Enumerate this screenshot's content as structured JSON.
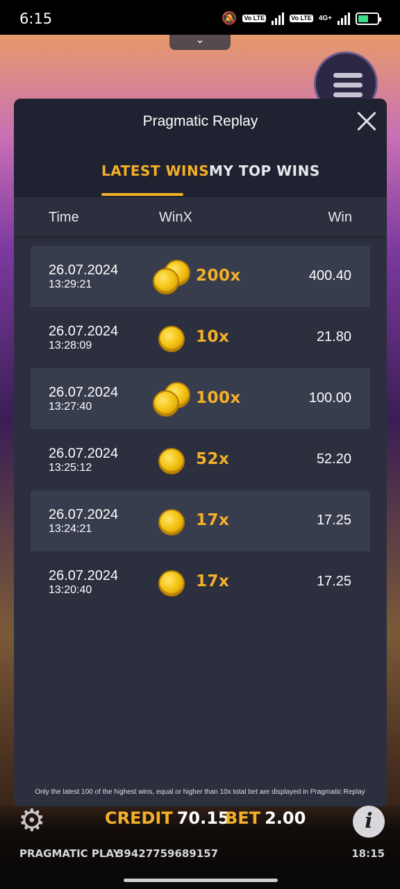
{
  "status_bar": {
    "time": "6:15",
    "volte1": "Vo LTE",
    "volte2": "Vo LTE",
    "network": "4G+"
  },
  "modal": {
    "title": "Pragmatic Replay",
    "tabs": [
      {
        "label": "LATEST WINS",
        "active": true
      },
      {
        "label": "MY TOP WINS",
        "active": false
      }
    ],
    "columns": {
      "time": "Time",
      "winx": "WinX",
      "win": "Win"
    },
    "rows": [
      {
        "date": "26.07.2024",
        "time": "13:29:21",
        "winx": "200x",
        "win": "400.40",
        "coins": 2
      },
      {
        "date": "26.07.2024",
        "time": "13:28:09",
        "winx": "10x",
        "win": "21.80",
        "coins": 1
      },
      {
        "date": "26.07.2024",
        "time": "13:27:40",
        "winx": "100x",
        "win": "100.00",
        "coins": 2
      },
      {
        "date": "26.07.2024",
        "time": "13:25:12",
        "winx": "52x",
        "win": "52.20",
        "coins": 1
      },
      {
        "date": "26.07.2024",
        "time": "13:24:21",
        "winx": "17x",
        "win": "17.25",
        "coins": 1
      },
      {
        "date": "26.07.2024",
        "time": "13:20:40",
        "winx": "17x",
        "win": "17.25",
        "coins": 1
      }
    ],
    "footer_note": "Only the latest 100 of the highest wins, equal or higher than 10x total bet are displayed in Pragmatic Replay"
  },
  "game_bar": {
    "credit_label": "CREDIT",
    "credit_value": "70.15",
    "bet_label": "BET",
    "bet_value": "2.00",
    "brand": "PRAGMATIC PLAY",
    "session_id": "39427759689157",
    "clock": "18:15"
  },
  "colors": {
    "accent": "#f5b028",
    "panel": "#2b2f3e",
    "header": "#1f2230",
    "row_shade": "#383d4e"
  }
}
